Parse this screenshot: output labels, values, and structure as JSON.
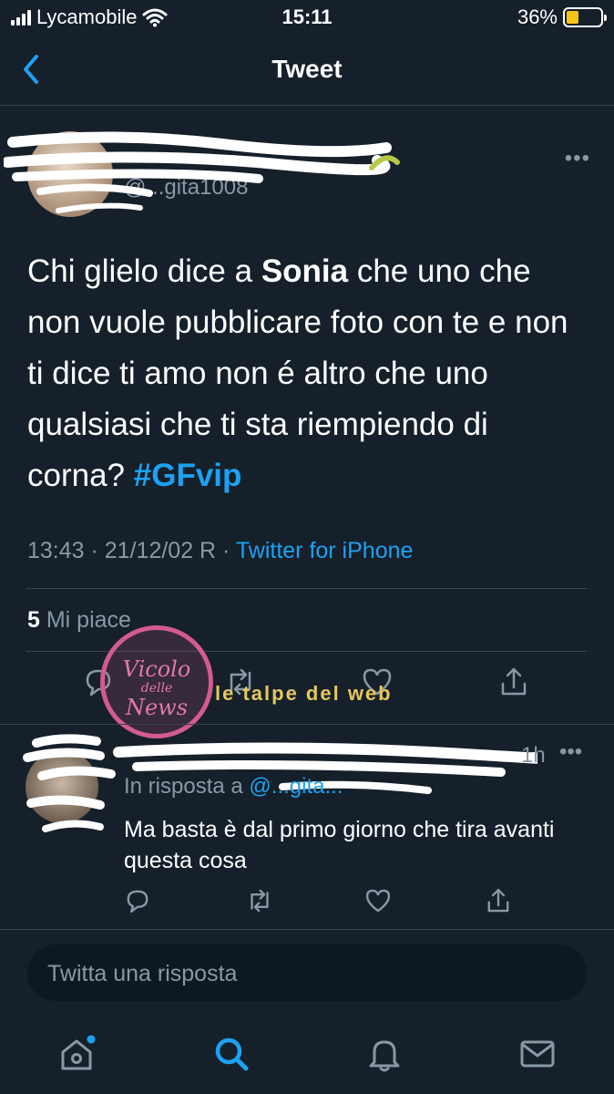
{
  "status_bar": {
    "carrier": "Lycamobile",
    "time": "15:11",
    "battery_percent": "36%",
    "battery_level": 0.36,
    "battery_color": "#f5c518"
  },
  "nav": {
    "title": "Tweet",
    "back_icon": "chevron-left-icon"
  },
  "tweet": {
    "handle": "@...gita1008",
    "text_pre": "Chi glielo dice a ",
    "text_bold": "Sonia",
    "text_post": " che uno che non vuole pubblicare foto con te e non ti dice ti amo non é altro che uno qualsiasi che ti sta riempiendo di corna? ",
    "hashtag": "#GFvip",
    "time": "13:43",
    "date_sep": " · ",
    "date": "21/12/02 R",
    "source_sep": " · ",
    "source": "Twitter for iPhone",
    "likes_count": "5",
    "likes_label": " Mi piace"
  },
  "reply": {
    "time": "1h",
    "in_reply_prefix": "In risposta a ",
    "in_reply_mention": "@...gita...",
    "text": "Ma basta è dal primo giorno che tira avanti questa cosa"
  },
  "compose": {
    "placeholder": "Twitta una risposta"
  },
  "watermarks": {
    "circle_top": "Vicolo",
    "circle_mid": "delle",
    "circle_bottom": "News",
    "banner": "le talpe del web"
  },
  "colors": {
    "background": "#15202b",
    "accent": "#1da1f2",
    "secondary_text": "#8899a6",
    "divider": "#38444d"
  },
  "tabs": [
    "home-icon",
    "search-icon",
    "notifications-bell-icon",
    "messages-envelope-icon"
  ]
}
